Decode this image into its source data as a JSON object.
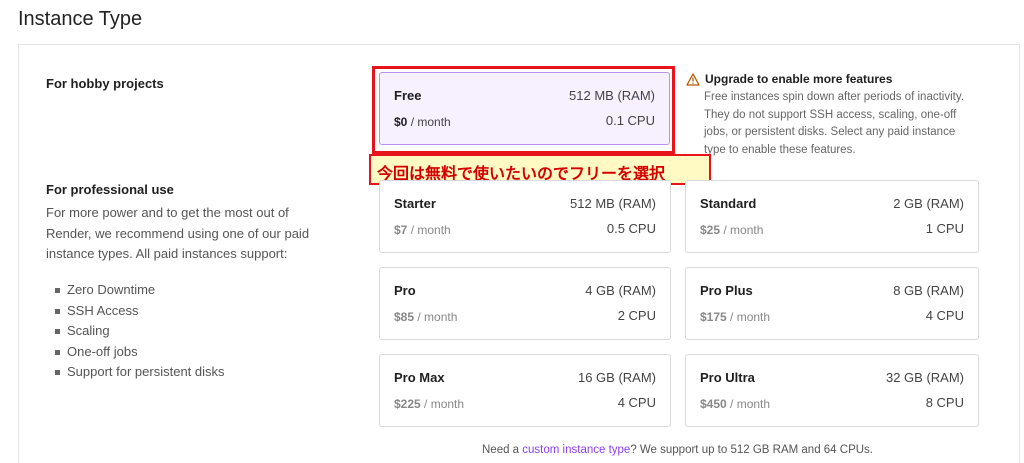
{
  "page_title": "Instance Type",
  "hobby": {
    "heading": "For hobby projects"
  },
  "professional": {
    "heading": "For professional use",
    "description": "For more power and to get the most out of Render, we recommend using one of our paid instance types. All paid instances support:",
    "features": [
      "Zero Downtime",
      "SSH Access",
      "Scaling",
      "One-off jobs",
      "Support for persistent disks"
    ]
  },
  "notice": {
    "title": "Upgrade to enable more features",
    "body": "Free instances spin down after periods of inactivity. They do not support SSH access, scaling, one-off jobs, or persistent disks. Select any paid instance type to enable these features."
  },
  "annotation": {
    "callout": "今回は無料で使いたいのでフリーを選択"
  },
  "instances": {
    "free": {
      "name": "Free",
      "ram": "512 MB (RAM)",
      "price": "$0",
      "period": "/ month",
      "cpu": "0.1 CPU",
      "selected": true
    },
    "starter": {
      "name": "Starter",
      "ram": "512 MB (RAM)",
      "price": "$7",
      "period": "/ month",
      "cpu": "0.5 CPU"
    },
    "standard": {
      "name": "Standard",
      "ram": "2 GB (RAM)",
      "price": "$25",
      "period": "/ month",
      "cpu": "1 CPU"
    },
    "pro": {
      "name": "Pro",
      "ram": "4 GB (RAM)",
      "price": "$85",
      "period": "/ month",
      "cpu": "2 CPU"
    },
    "pro_plus": {
      "name": "Pro Plus",
      "ram": "8 GB (RAM)",
      "price": "$175",
      "period": "/ month",
      "cpu": "4 CPU"
    },
    "pro_max": {
      "name": "Pro Max",
      "ram": "16 GB (RAM)",
      "price": "$225",
      "period": "/ month",
      "cpu": "4 CPU"
    },
    "pro_ultra": {
      "name": "Pro Ultra",
      "ram": "32 GB (RAM)",
      "price": "$450",
      "period": "/ month",
      "cpu": "8 CPU"
    }
  },
  "footer": {
    "prefix": "Need a ",
    "link": "custom instance type",
    "suffix": "? We support up to 512 GB RAM and 64 CPUs."
  },
  "colors": {
    "accent": "#8a3ffc",
    "selected_bg": "#f6f0ff",
    "annotation_red": "#e8141b",
    "annotation_bg": "#fff9c4"
  }
}
